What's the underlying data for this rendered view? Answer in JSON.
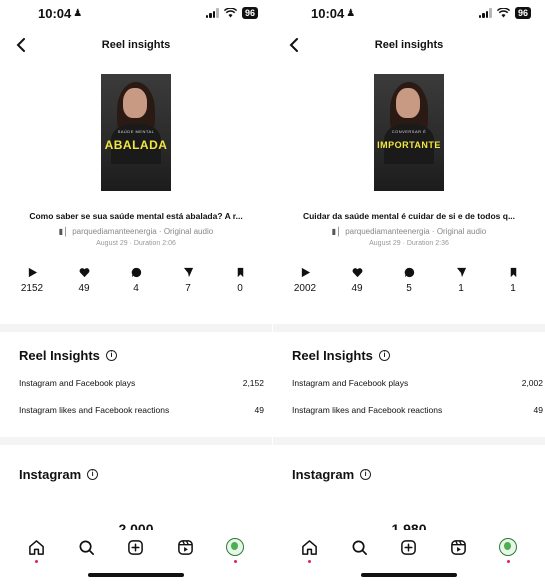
{
  "screens": [
    {
      "status": {
        "time": "10:04",
        "battery": "96"
      },
      "header": {
        "title": "Reel insights",
        "back_icon": "chevron-left-icon"
      },
      "thumbnail": {
        "overlay_small": "SAÚDE MENTAL",
        "overlay_big": "ABALADA",
        "overlay_color": "#f2e640",
        "footer": ""
      },
      "reel": {
        "title": "Como saber se sua saúde mental está abalada? A r...",
        "audio": "parquediamanteenergia · Original audio",
        "meta": "August 29 · Duration 2:06"
      },
      "stats": [
        {
          "icon": "play-icon",
          "value": "2152"
        },
        {
          "icon": "heart-icon",
          "value": "49"
        },
        {
          "icon": "comment-icon",
          "value": "4"
        },
        {
          "icon": "share-icon",
          "value": "7"
        },
        {
          "icon": "bookmark-icon",
          "value": "0"
        }
      ],
      "insights": {
        "title": "Reel Insights",
        "rows": [
          {
            "label": "Instagram and Facebook plays",
            "value": "2,152"
          },
          {
            "label": "Instagram likes and Facebook reactions",
            "value": "49"
          }
        ]
      },
      "instagram": {
        "title": "Instagram",
        "partial_number": "2,000"
      }
    },
    {
      "status": {
        "time": "10:04",
        "battery": "96"
      },
      "header": {
        "title": "Reel insights",
        "back_icon": "chevron-left-icon"
      },
      "thumbnail": {
        "overlay_small": "CONVERSAR É",
        "overlay_big": "IMPORTANTE",
        "overlay_color": "#f2e640",
        "footer": ""
      },
      "reel": {
        "title": "Cuidar da saúde mental é cuidar de si e de todos q...",
        "audio": "parquediamanteenergia · Original audio",
        "meta": "August 29 · Duration 2:36"
      },
      "stats": [
        {
          "icon": "play-icon",
          "value": "2002"
        },
        {
          "icon": "heart-icon",
          "value": "49"
        },
        {
          "icon": "comment-icon",
          "value": "5"
        },
        {
          "icon": "share-icon",
          "value": "1"
        },
        {
          "icon": "bookmark-icon",
          "value": "1"
        }
      ],
      "insights": {
        "title": "Reel Insights",
        "rows": [
          {
            "label": "Instagram and Facebook plays",
            "value": "2,002"
          },
          {
            "label": "Instagram likes and Facebook reactions",
            "value": "49"
          }
        ]
      },
      "instagram": {
        "title": "Instagram",
        "partial_number": "1,980"
      }
    }
  ],
  "tab_bar": {
    "items": [
      "home-icon",
      "search-icon",
      "create-icon",
      "reels-icon",
      "profile-avatar"
    ],
    "notification_color": "#e0245e"
  }
}
